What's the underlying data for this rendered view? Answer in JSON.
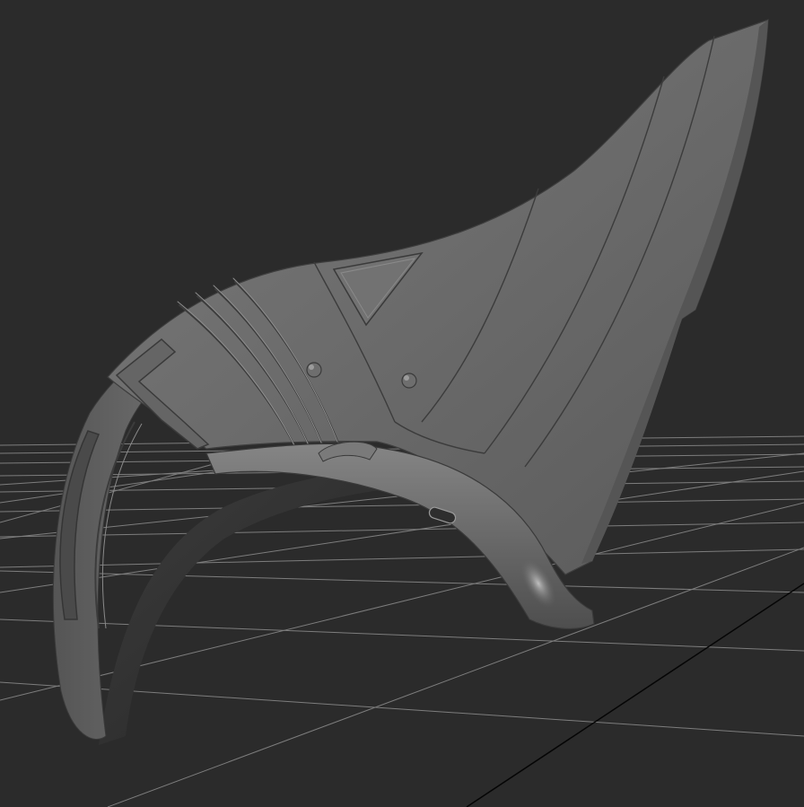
{
  "scene": {
    "background_color": "#2b2b2b",
    "grid_line_color": "#8a8a8a",
    "grid_axis_color": "#050505",
    "model_base_color": "#6a6a6a",
    "model_highlight_color": "#9a9a9a",
    "model_shadow_color": "#3a3a3a",
    "floor_grid_visible": true,
    "object": "sculpted-armor-piece"
  }
}
